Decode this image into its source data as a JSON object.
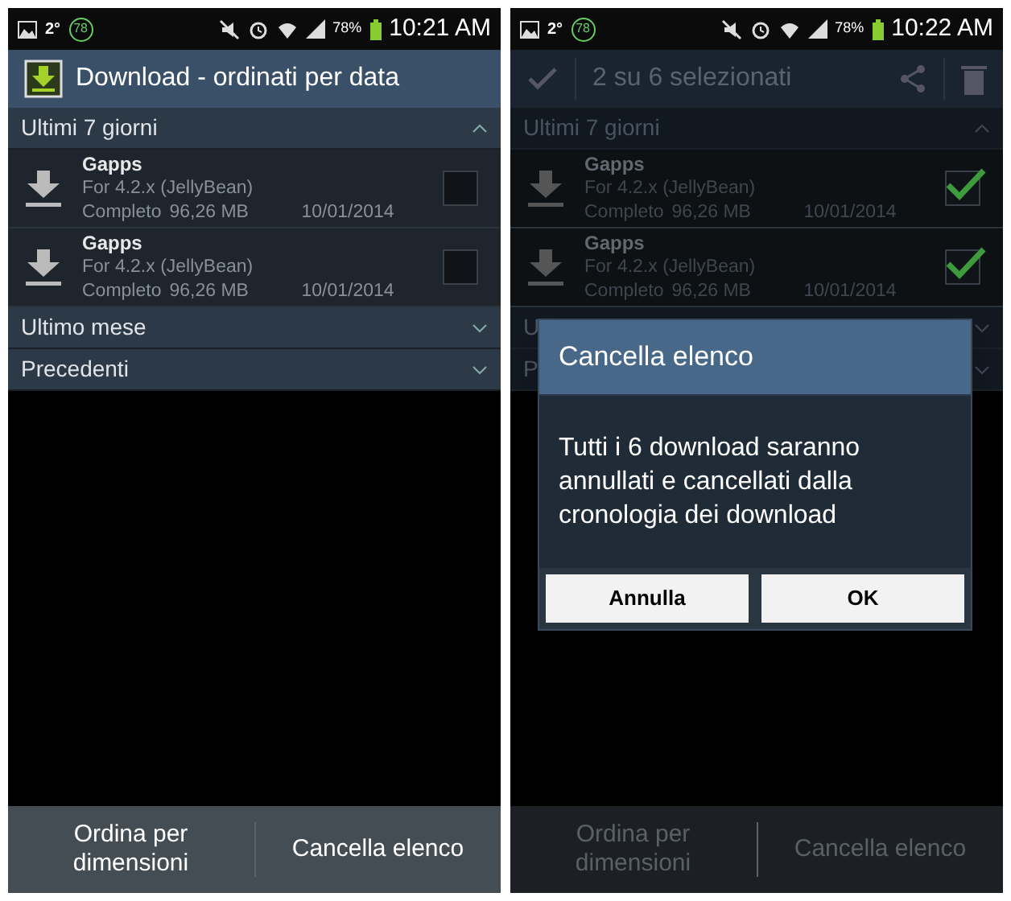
{
  "screens": [
    {
      "dimmed": false,
      "status_bar": {
        "temperature": "2°",
        "badge": "78",
        "battery": "78%",
        "time": "10:21 AM"
      },
      "action_bar": {
        "kind": "title",
        "title": "Download - ordinati per data"
      },
      "sections": [
        {
          "title": "Ultimi 7 giorni",
          "expanded": true,
          "items": [
            {
              "name": "Gapps",
              "subtitle": "For 4.2.x (JellyBean)",
              "status": "Completo",
              "size": "96,26 MB",
              "date": "10/01/2014",
              "checked": false
            },
            {
              "name": "Gapps",
              "subtitle": "For 4.2.x (JellyBean)",
              "status": "Completo",
              "size": "96,26 MB",
              "date": "10/01/2014",
              "checked": false
            }
          ]
        },
        {
          "title": "Ultimo mese",
          "expanded": false
        },
        {
          "title": "Precedenti",
          "expanded": false
        }
      ],
      "bottom_buttons": [
        {
          "label": "Ordina per dimensioni",
          "disabled": false
        },
        {
          "label": "Cancella elenco",
          "disabled": false
        }
      ]
    },
    {
      "dimmed": true,
      "status_bar": {
        "temperature": "2°",
        "badge": "78",
        "battery": "78%",
        "time": "10:22 AM"
      },
      "action_bar": {
        "kind": "selection",
        "title": "2 su 6 selezionati"
      },
      "sections": [
        {
          "title": "Ultimi 7 giorni",
          "expanded": true,
          "items": [
            {
              "name": "Gapps",
              "subtitle": "For 4.2.x (JellyBean)",
              "status": "Completo",
              "size": "96,26 MB",
              "date": "10/01/2014",
              "checked": true
            },
            {
              "name": "Gapps",
              "subtitle": "For 4.2.x (JellyBean)",
              "status": "Completo",
              "size": "96,26 MB",
              "date": "10/01/2014",
              "checked": true
            }
          ]
        },
        {
          "title": "U",
          "expanded": false
        },
        {
          "title": "P",
          "expanded": false
        }
      ],
      "dialog": {
        "title": "Cancella elenco",
        "message": "Tutti i 6 download saranno annullati e cancellati dalla cronologia dei download",
        "buttons": [
          "Annulla",
          "OK"
        ]
      },
      "bottom_buttons": [
        {
          "label": "Ordina per dimensioni",
          "disabled": true
        },
        {
          "label": "Cancella elenco",
          "disabled": true
        }
      ]
    }
  ]
}
